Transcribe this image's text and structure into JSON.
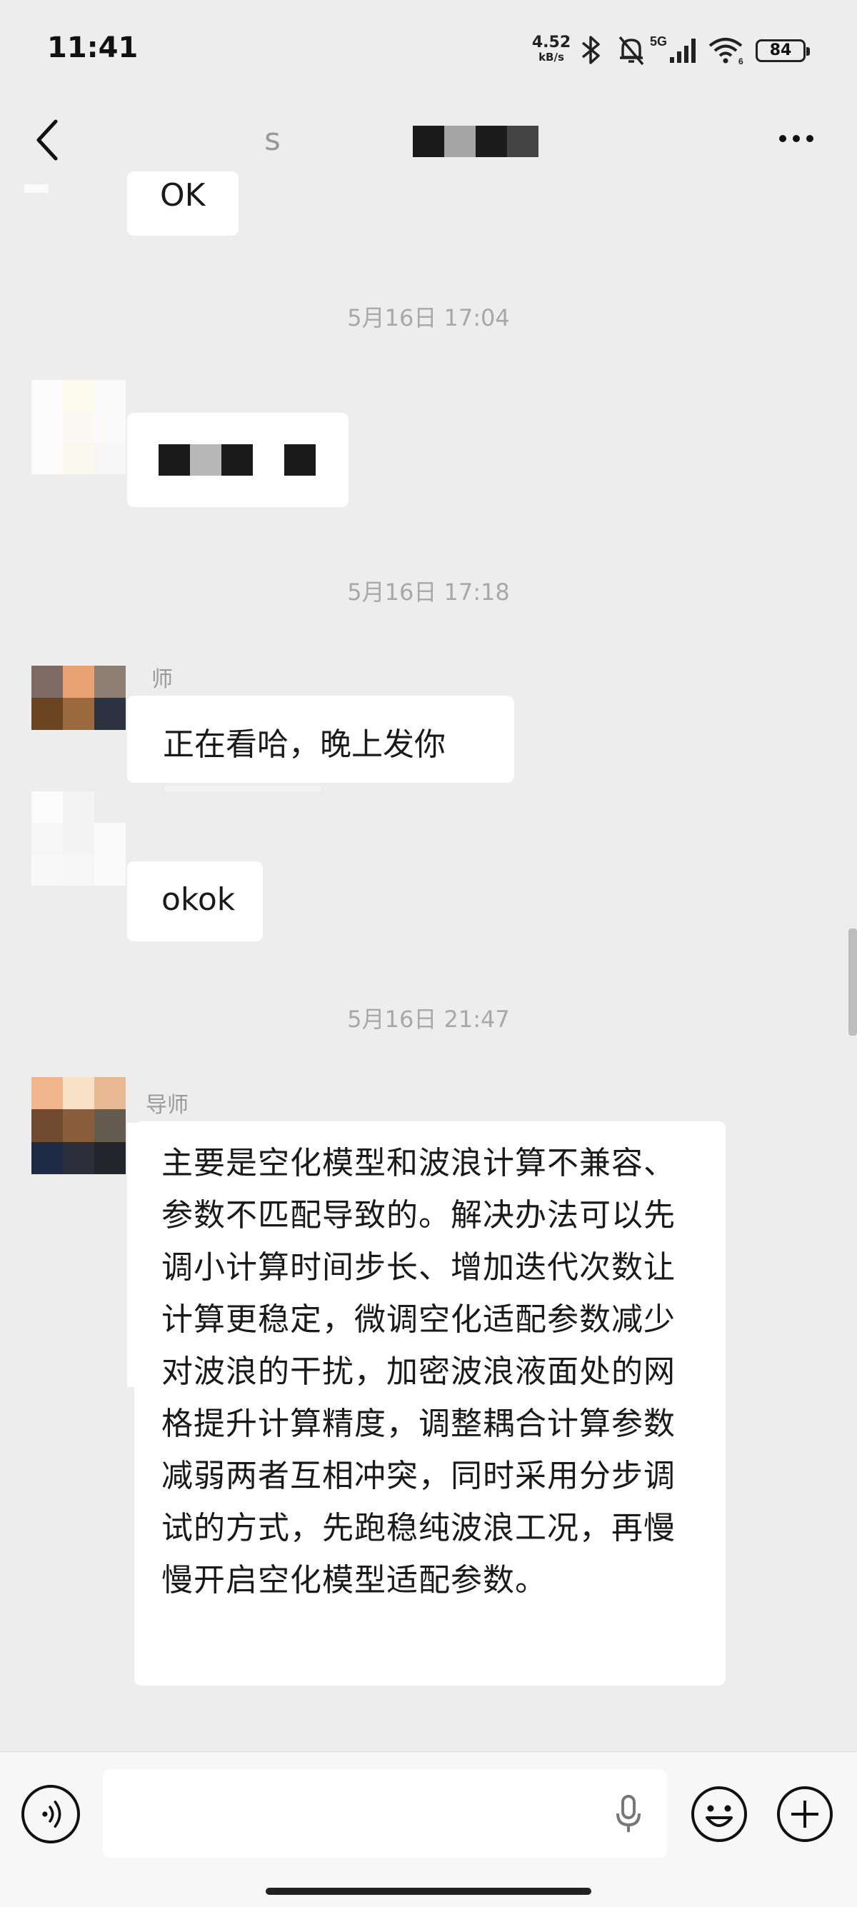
{
  "status_bar": {
    "time": "11:41",
    "net_speed_value": "4.52",
    "net_speed_unit": "kB/s",
    "battery": "84",
    "icons": [
      "bluetooth-icon",
      "bell-muted-icon",
      "signal-5g-icon",
      "wifi-icon",
      "battery-icon"
    ]
  },
  "nav": {
    "back_icon": "chevron-left-icon",
    "title_visible": "s",
    "more_icon": "more-dots-icon"
  },
  "messages": {
    "first_bubble": "OK",
    "ts1": "5月16日 17:04",
    "ts2": "5月16日 17:18",
    "sender1_name": "师",
    "msg_reading": "正在看哈，晚上发你",
    "msg_okok": "okok",
    "ts3": "5月16日 21:47",
    "sender2_name": "导师",
    "long_message": "主要是空化模型和波浪计算不兼容、参数不匹配导致的。解决办法可以先调小计算时间步长、增加迭代次数让计算更稳定，微调空化适配参数减少对波浪的干扰，加密波浪液面处的网格提升计算精度，调整耦合计算参数减弱两者互相冲突，同时采用分步调试的方式，先跑稳纯波浪工况，再慢慢开启空化模型适配参数。"
  },
  "input_bar": {
    "voice_icon": "voice-icon",
    "mic_icon": "mic-icon",
    "emoji_icon": "emoji-icon",
    "plus_icon": "plus-icon",
    "input_value": ""
  },
  "colors": {
    "background": "#ededed",
    "bubble": "#ffffff",
    "timestamp": "#a8a8a8"
  }
}
